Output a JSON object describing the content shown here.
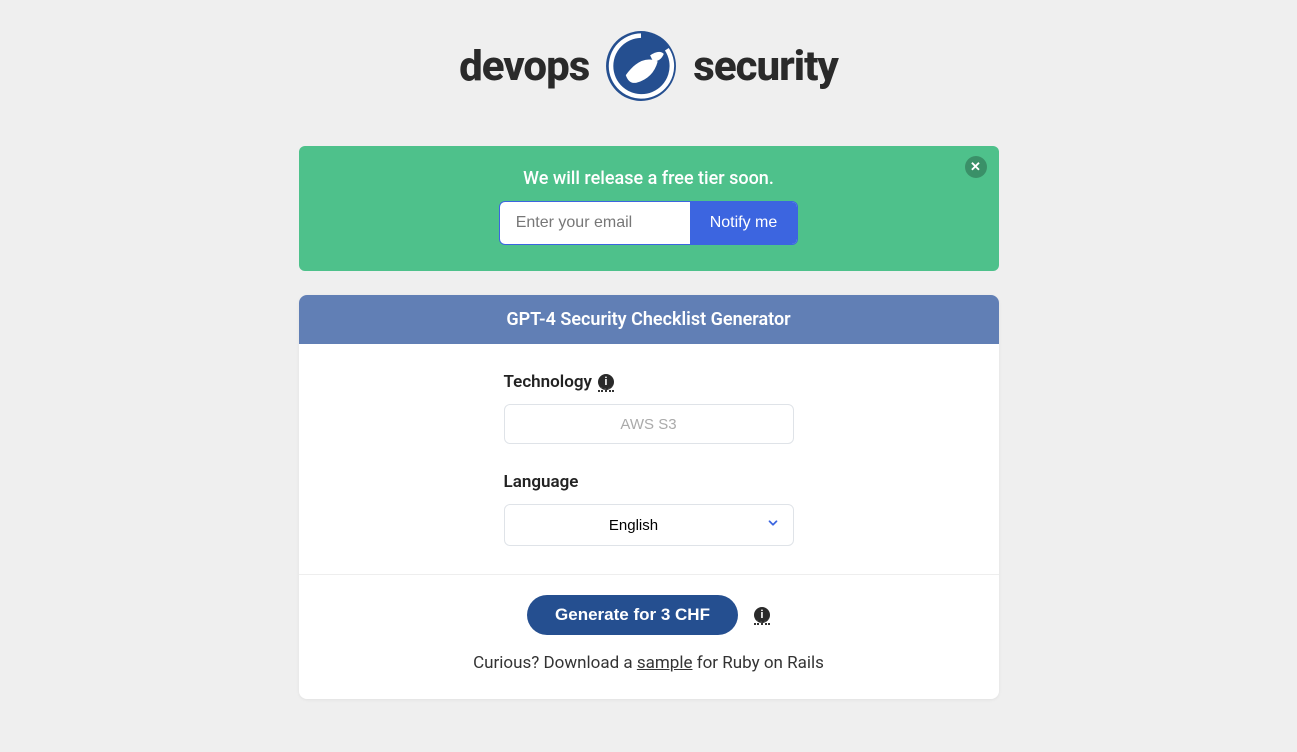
{
  "logo": {
    "left": "devops",
    "right": "security"
  },
  "banner": {
    "title": "We will release a free tier soon.",
    "email_placeholder": "Enter your email",
    "notify_label": "Notify me"
  },
  "card": {
    "header": "GPT-4 Security Checklist Generator",
    "technology_label": "Technology",
    "technology_placeholder": "AWS S3",
    "language_label": "Language",
    "language_value": "English",
    "generate_label": "Generate for 3 CHF",
    "footer_note_prefix": "Curious? Download a ",
    "footer_note_link": "sample",
    "footer_note_suffix": " for Ruby on Rails"
  }
}
